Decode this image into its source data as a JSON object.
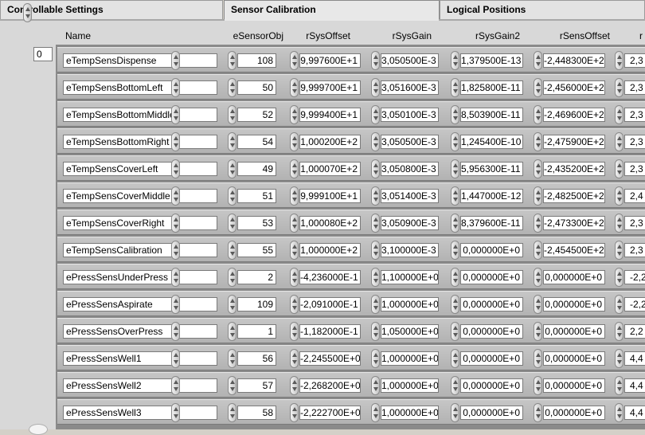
{
  "tabs": [
    {
      "label": "Controllable Settings"
    },
    {
      "label": "Sensor Calibration"
    },
    {
      "label": "Logical Positions"
    }
  ],
  "array_index": "0",
  "columns": [
    "Name",
    "eSensorObj",
    "rSysOffset",
    "rSysGain",
    "rSysGain2",
    "rSensOffset",
    "r"
  ],
  "rows": [
    {
      "name": "eTempSensDispense",
      "obj": "108",
      "sysOffset": "9,997600E+1",
      "sysGain": "3,050500E-3",
      "sysGain2": "1,379500E-13",
      "sensOffset": "-2,448300E+2",
      "next": "2,3"
    },
    {
      "name": "eTempSensBottomLeft",
      "obj": "50",
      "sysOffset": "9,999700E+1",
      "sysGain": "3,051600E-3",
      "sysGain2": "1,825800E-11",
      "sensOffset": "-2,456000E+2",
      "next": "2,3"
    },
    {
      "name": "eTempSensBottomMiddle",
      "obj": "52",
      "sysOffset": "9,999400E+1",
      "sysGain": "3,050100E-3",
      "sysGain2": "8,503900E-11",
      "sensOffset": "-2,469600E+2",
      "next": "2,3"
    },
    {
      "name": "eTempSensBottomRight",
      "obj": "54",
      "sysOffset": "1,000200E+2",
      "sysGain": "3,050500E-3",
      "sysGain2": "1,245400E-10",
      "sensOffset": "-2,475900E+2",
      "next": "2,3"
    },
    {
      "name": "eTempSensCoverLeft",
      "obj": "49",
      "sysOffset": "1,000070E+2",
      "sysGain": "3,050800E-3",
      "sysGain2": "5,956300E-11",
      "sensOffset": "-2,435200E+2",
      "next": "2,3"
    },
    {
      "name": "eTempSensCoverMiddle",
      "obj": "51",
      "sysOffset": "9,999100E+1",
      "sysGain": "3,051400E-3",
      "sysGain2": "1,447000E-12",
      "sensOffset": "-2,482500E+2",
      "next": "2,4"
    },
    {
      "name": "eTempSensCoverRight",
      "obj": "53",
      "sysOffset": "1,000080E+2",
      "sysGain": "3,050900E-3",
      "sysGain2": "8,379600E-11",
      "sensOffset": "-2,473300E+2",
      "next": "2,3"
    },
    {
      "name": "eTempSensCalibration",
      "obj": "55",
      "sysOffset": "1,000000E+2",
      "sysGain": "3,100000E-3",
      "sysGain2": "0,000000E+0",
      "sensOffset": "-2,454500E+2",
      "next": "2,3"
    },
    {
      "name": "ePressSensUnderPress",
      "obj": "2",
      "sysOffset": "-4,236000E-1",
      "sysGain": "1,100000E+0",
      "sysGain2": "0,000000E+0",
      "sensOffset": "0,000000E+0",
      "next": "-2,2"
    },
    {
      "name": "ePressSensAspirate",
      "obj": "109",
      "sysOffset": "-2,091000E-1",
      "sysGain": "1,000000E+0",
      "sysGain2": "0,000000E+0",
      "sensOffset": "0,000000E+0",
      "next": "-2,2"
    },
    {
      "name": "ePressSensOverPress",
      "obj": "1",
      "sysOffset": "-1,182000E-1",
      "sysGain": "1,050000E+0",
      "sysGain2": "0,000000E+0",
      "sensOffset": "0,000000E+0",
      "next": "2,2"
    },
    {
      "name": "ePressSensWell1",
      "obj": "56",
      "sysOffset": "-2,245500E+0",
      "sysGain": "1,000000E+0",
      "sysGain2": "0,000000E+0",
      "sensOffset": "0,000000E+0",
      "next": "4,4"
    },
    {
      "name": "ePressSensWell2",
      "obj": "57",
      "sysOffset": "-2,268200E+0",
      "sysGain": "1,000000E+0",
      "sysGain2": "0,000000E+0",
      "sensOffset": "0,000000E+0",
      "next": "4,4"
    },
    {
      "name": "ePressSensWell3",
      "obj": "58",
      "sysOffset": "-2,222700E+0",
      "sysGain": "1,000000E+0",
      "sysGain2": "0,000000E+0",
      "sensOffset": "0,000000E+0",
      "next": "4,4"
    }
  ]
}
